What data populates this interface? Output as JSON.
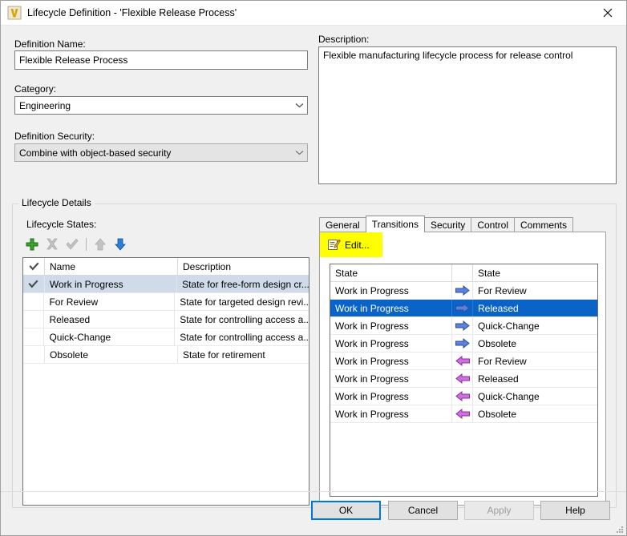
{
  "window": {
    "title": "Lifecycle Definition - 'Flexible Release Process'",
    "icon": "vault-v-icon",
    "close_label": "close-icon"
  },
  "form": {
    "definition_name_label": "Definition Name:",
    "definition_name_value": "Flexible Release Process",
    "definition_name_placeholder": "",
    "category_label": "Category:",
    "category_value": "Engineering",
    "security_label": "Definition Security:",
    "security_value": "Combine with object-based security",
    "description_label": "Description:",
    "description_value": "Flexible manufacturing lifecycle process for release control"
  },
  "details": {
    "group_title": "Lifecycle Details",
    "states_label": "Lifecycle States:",
    "toolbar": [
      {
        "name": "add-state-button",
        "icon": "plus-icon",
        "enabled": true
      },
      {
        "name": "delete-state-button",
        "icon": "delete-x-icon",
        "enabled": false
      },
      {
        "name": "set-default-state-button",
        "icon": "check-icon",
        "enabled": false
      },
      {
        "name": "move-up-button",
        "icon": "arrow-up-icon",
        "enabled": false
      },
      {
        "name": "move-down-button",
        "icon": "arrow-down-icon",
        "enabled": true
      }
    ],
    "states_columns": [
      "",
      "Name",
      "Description"
    ],
    "states_rows": [
      {
        "checked": true,
        "name": "Work in Progress",
        "description": "State for free-form design cr...",
        "selected": true
      },
      {
        "checked": false,
        "name": "For Review",
        "description": "State for targeted design revi...",
        "selected": false
      },
      {
        "checked": false,
        "name": "Released",
        "description": "State for controlling access a...",
        "selected": false
      },
      {
        "checked": false,
        "name": "Quick-Change",
        "description": "State for controlling access a...",
        "selected": false
      },
      {
        "checked": false,
        "name": "Obsolete",
        "description": "State for retirement",
        "selected": false
      }
    ]
  },
  "tabs": {
    "items": [
      {
        "label": "General",
        "active": false
      },
      {
        "label": "Transitions",
        "active": true
      },
      {
        "label": "Security",
        "active": false
      },
      {
        "label": "Control",
        "active": false
      },
      {
        "label": "Comments",
        "active": false
      }
    ]
  },
  "transitions": {
    "edit_label": "Edit...",
    "edit_icon": "edit-document-pencil-icon",
    "highlight_color": "#ffff00",
    "columns": [
      "State",
      "",
      "State"
    ],
    "rows": [
      {
        "from": "Work in Progress",
        "direction": "out",
        "to": "For Review",
        "selected": false
      },
      {
        "from": "Work in Progress",
        "direction": "out",
        "to": "Released",
        "selected": true
      },
      {
        "from": "Work in Progress",
        "direction": "out",
        "to": "Quick-Change",
        "selected": false
      },
      {
        "from": "Work in Progress",
        "direction": "out",
        "to": "Obsolete",
        "selected": false
      },
      {
        "from": "Work in Progress",
        "direction": "in",
        "to": "For Review",
        "selected": false
      },
      {
        "from": "Work in Progress",
        "direction": "in",
        "to": "Released",
        "selected": false
      },
      {
        "from": "Work in Progress",
        "direction": "in",
        "to": "Quick-Change",
        "selected": false
      },
      {
        "from": "Work in Progress",
        "direction": "in",
        "to": "Obsolete",
        "selected": false
      }
    ],
    "arrow_out_color": "#4a6fd4",
    "arrow_in_color": "#c060d8"
  },
  "footer": {
    "ok_label": "OK",
    "cancel_label": "Cancel",
    "apply_label": "Apply",
    "help_label": "Help",
    "apply_enabled": false,
    "ok_default": true
  }
}
